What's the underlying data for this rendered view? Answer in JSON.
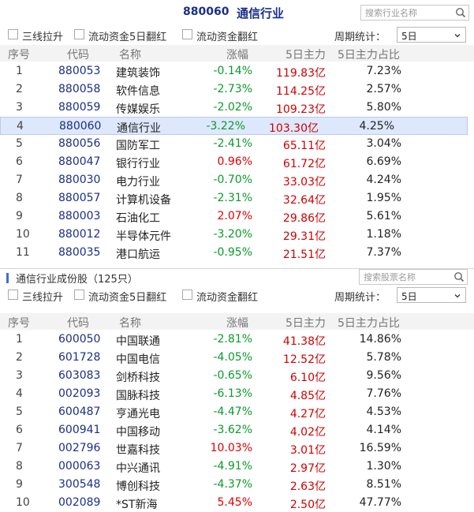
{
  "header": {
    "code": "880060",
    "name": "通信行业",
    "search_placeholder": "搜索行业名称"
  },
  "filters1": {
    "opt1": "三线拉升",
    "opt2": "流动资金5日翻红",
    "opt3": "流动资金翻红",
    "period_label": "周期统计：",
    "period_value": "5日"
  },
  "columns": {
    "idx": "序号",
    "code": "代码",
    "name": "名称",
    "change": "涨幅",
    "main5": "5日主力",
    "ratio": "5日主力占比"
  },
  "industries": [
    {
      "idx": "1",
      "code": "880053",
      "name": "建筑装饰",
      "change": "-0.14%",
      "dir": "dn",
      "main": "119.83亿",
      "ratio": "7.23%"
    },
    {
      "idx": "2",
      "code": "880058",
      "name": "软件信息",
      "change": "-2.73%",
      "dir": "dn",
      "main": "114.25亿",
      "ratio": "2.57%"
    },
    {
      "idx": "3",
      "code": "880059",
      "name": "传媒娱乐",
      "change": "-2.02%",
      "dir": "dn",
      "main": "109.23亿",
      "ratio": "5.80%"
    },
    {
      "idx": "4",
      "code": "880060",
      "name": "通信行业",
      "change": "-3.22%",
      "dir": "dn",
      "main": "103.30亿",
      "ratio": "4.25%"
    },
    {
      "idx": "5",
      "code": "880056",
      "name": "国防军工",
      "change": "-2.41%",
      "dir": "dn",
      "main": "65.11亿",
      "ratio": "3.04%"
    },
    {
      "idx": "6",
      "code": "880047",
      "name": "银行行业",
      "change": "0.96%",
      "dir": "up",
      "main": "61.72亿",
      "ratio": "6.69%"
    },
    {
      "idx": "7",
      "code": "880030",
      "name": "电力行业",
      "change": "-0.70%",
      "dir": "dn",
      "main": "33.03亿",
      "ratio": "4.24%"
    },
    {
      "idx": "8",
      "code": "880057",
      "name": "计算机设备",
      "change": "-2.31%",
      "dir": "dn",
      "main": "32.64亿",
      "ratio": "1.95%"
    },
    {
      "idx": "9",
      "code": "880003",
      "name": "石油化工",
      "change": "2.07%",
      "dir": "up",
      "main": "29.86亿",
      "ratio": "5.61%"
    },
    {
      "idx": "10",
      "code": "880012",
      "name": "半导体元件",
      "change": "-3.20%",
      "dir": "dn",
      "main": "29.31亿",
      "ratio": "1.18%"
    },
    {
      "idx": "11",
      "code": "880035",
      "name": "港口航运",
      "change": "-0.95%",
      "dir": "dn",
      "main": "21.51亿",
      "ratio": "7.37%"
    }
  ],
  "selected_industry_index": 3,
  "constituents": {
    "title": "通信行业成份股",
    "count": "（125只）",
    "search_placeholder": "搜索股票名称"
  },
  "filters2": {
    "opt1": "三线拉升",
    "opt2": "流动资金5日翻红",
    "opt3": "流动资金翻红",
    "period_label": "周期统计：",
    "period_value": "5日"
  },
  "stocks": [
    {
      "idx": "1",
      "code": "600050",
      "name": "中国联通",
      "change": "-2.81%",
      "dir": "dn",
      "main": "41.38亿",
      "ratio": "14.86%"
    },
    {
      "idx": "2",
      "code": "601728",
      "name": "中国电信",
      "change": "-4.05%",
      "dir": "dn",
      "main": "12.52亿",
      "ratio": "5.78%"
    },
    {
      "idx": "3",
      "code": "603083",
      "name": "剑桥科技",
      "change": "-0.65%",
      "dir": "dn",
      "main": "6.10亿",
      "ratio": "9.56%"
    },
    {
      "idx": "4",
      "code": "002093",
      "name": "国脉科技",
      "change": "-6.13%",
      "dir": "dn",
      "main": "4.85亿",
      "ratio": "7.76%"
    },
    {
      "idx": "5",
      "code": "600487",
      "name": "亨通光电",
      "change": "-4.47%",
      "dir": "dn",
      "main": "4.27亿",
      "ratio": "4.53%"
    },
    {
      "idx": "6",
      "code": "600941",
      "name": "中国移动",
      "change": "-3.62%",
      "dir": "dn",
      "main": "4.02亿",
      "ratio": "4.14%"
    },
    {
      "idx": "7",
      "code": "002796",
      "name": "世嘉科技",
      "change": "10.03%",
      "dir": "up",
      "main": "3.01亿",
      "ratio": "16.59%"
    },
    {
      "idx": "8",
      "code": "000063",
      "name": "中兴通讯",
      "change": "-4.91%",
      "dir": "dn",
      "main": "2.97亿",
      "ratio": "1.30%"
    },
    {
      "idx": "9",
      "code": "300548",
      "name": "博创科技",
      "change": "-4.37%",
      "dir": "dn",
      "main": "2.63亿",
      "ratio": "8.51%"
    },
    {
      "idx": "10",
      "code": "002089",
      "name": "*ST新海",
      "change": "5.45%",
      "dir": "up",
      "main": "2.50亿",
      "ratio": "47.77%"
    }
  ],
  "colors": {
    "up": "#e00000",
    "down": "#0a9a2a",
    "code": "#1a2f8a",
    "selected_row": "#dde8fc"
  }
}
